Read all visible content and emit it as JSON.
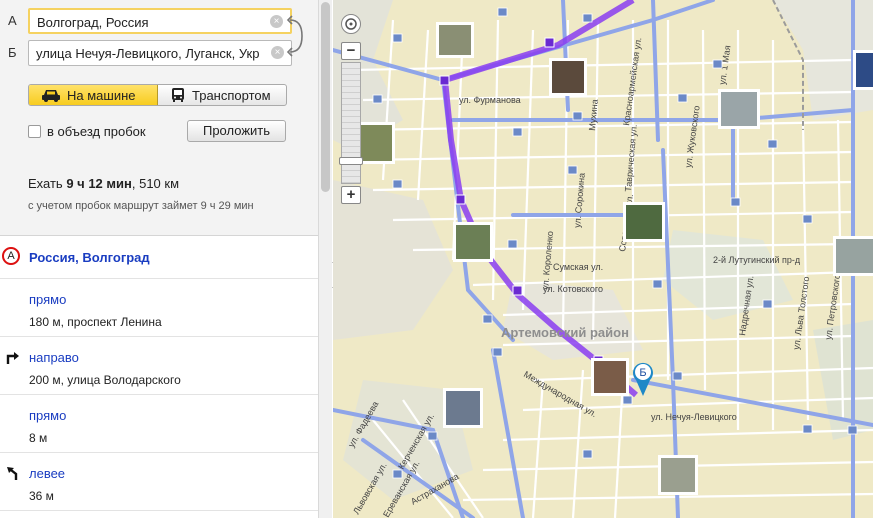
{
  "route_form": {
    "point_a_label": "А",
    "point_a_value": "Волгоград, Россия",
    "point_b_label": "Б",
    "point_b_value": "улица Нечуя-Левицкого, Луганск, Укр",
    "mode_car_label": "На машине",
    "mode_transit_label": "Транспортом",
    "selected_mode": "car",
    "avoid_traffic_label": "в объезд пробок",
    "avoid_traffic_checked": false,
    "build_button_label": "Проложить"
  },
  "summary": {
    "prefix": "Ехать ",
    "time": "9 ч 12 мин",
    "distance": ", 510 км",
    "traffic_note": "с учетом пробок маршрут займет 9 ч 29 мин"
  },
  "start": {
    "marker": "А",
    "label": "Россия, Волгоград"
  },
  "steps": [
    {
      "icon": "straight",
      "title": "прямо",
      "detail": "180 м, проспект Ленина"
    },
    {
      "icon": "turn-right-icon",
      "title": "направо",
      "detail": "200 м, улица Володарского"
    },
    {
      "icon": "straight",
      "title": "прямо",
      "detail": "8 м"
    },
    {
      "icon": "turn-slight-left-icon",
      "title": "левее",
      "detail": "36 м"
    }
  ],
  "map": {
    "district_label": "Артемовский район",
    "end_marker": "Б",
    "route_color": "#8a3df0",
    "streets": [
      "ул. Фурманова",
      "Красноармейская ул.",
      "ул. 1 Мая",
      "Таврическая ул.",
      "Мухина",
      "ул. Жуковского",
      "ул. Короленко",
      "ул. Сорокина",
      "Советская ул.",
      "Сумская ул.",
      "ул. Котовского",
      "2-й Лутугинский пр-д",
      "Надречная ул.",
      "ул. Льва Толстого",
      "ул. Петровского",
      "Международная ул.",
      "ул. Фадеева",
      "Львовская ул.",
      "Керченская ул.",
      "Ереванская ул.",
      "Астраханова",
      "ул. Нечуя-Левицкого"
    ]
  },
  "colors": {
    "link": "#1a3dc1",
    "accent_toggle": "#f7cc1f",
    "map_background": "#eee8c6"
  }
}
